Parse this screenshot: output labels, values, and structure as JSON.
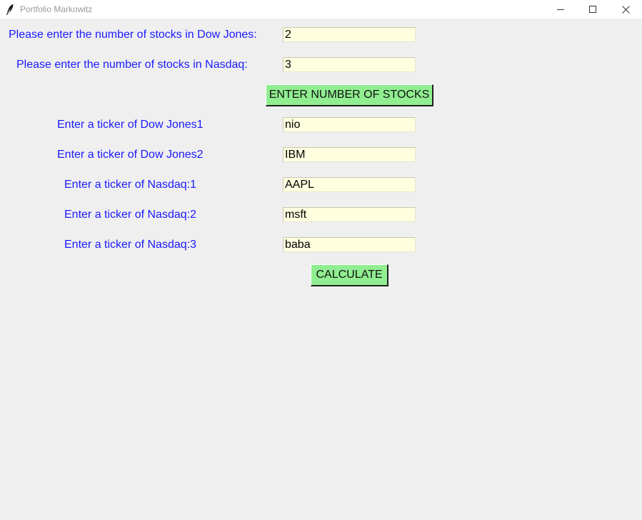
{
  "window": {
    "title": "Portfolio Markowitz"
  },
  "colors": {
    "background": "#efefef",
    "label_text": "#1a1aff",
    "entry_background": "#ffffe0",
    "button_background": "#90ee90"
  },
  "form": {
    "dow_count_label": "Please enter the number of stocks in Dow Jones:",
    "dow_count_value": "2",
    "nasdaq_count_label": "Please enter the number of stocks in Nasdaq:",
    "nasdaq_count_value": "3",
    "enter_button_label": "ENTER NUMBER OF STOCKS",
    "tickers": [
      {
        "label": "Enter a ticker of Dow Jones1",
        "value": "nio"
      },
      {
        "label": "Enter a ticker of Dow Jones2",
        "value": "IBM"
      },
      {
        "label": "Enter a ticker of Nasdaq:1",
        "value": "AAPL"
      },
      {
        "label": "Enter a ticker of Nasdaq:2",
        "value": "msft"
      },
      {
        "label": "Enter a ticker of Nasdaq:3",
        "value": "baba"
      }
    ],
    "calculate_button_label": "CALCULATE"
  },
  "icons": {
    "app": "feather-icon",
    "minimize": "minimize-icon",
    "maximize": "maximize-icon",
    "close": "close-icon"
  }
}
